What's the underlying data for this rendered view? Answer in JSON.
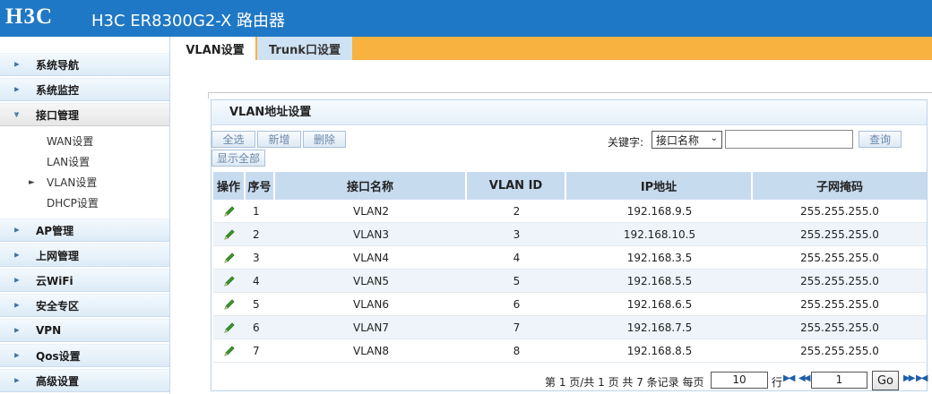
{
  "header": {
    "logo": "H3C",
    "title": "H3C ER8300G2-X 路由器"
  },
  "sidebar": {
    "groups": [
      {
        "label": "系统导航"
      },
      {
        "label": "系统监控"
      },
      {
        "label": "接口管理",
        "open": true
      },
      {
        "label": "AP管理"
      },
      {
        "label": "上网管理"
      },
      {
        "label": "云WiFi"
      },
      {
        "label": "安全专区"
      },
      {
        "label": "VPN"
      },
      {
        "label": "Qos设置"
      },
      {
        "label": "高级设置"
      }
    ],
    "subitems": [
      "WAN设置",
      "LAN设置",
      "VLAN设置",
      "DHCP设置"
    ],
    "active_sub": "VLAN设置"
  },
  "tabs": {
    "active": "VLAN设置",
    "other": "Trunk口设置"
  },
  "panel": {
    "title": "VLAN地址设置",
    "buttons": {
      "select_all": "全选",
      "add": "新增",
      "delete": "删除",
      "show_all": "显示全部"
    },
    "search": {
      "label": "关键字:",
      "selected": "接口名称",
      "value": "",
      "button": "查询"
    }
  },
  "table": {
    "headers": [
      "操作",
      "序号",
      "接口名称",
      "VLAN ID",
      "IP地址",
      "子网掩码"
    ],
    "rows": [
      [
        "1",
        "VLAN2",
        "2",
        "192.168.9.5",
        "255.255.255.0"
      ],
      [
        "2",
        "VLAN3",
        "3",
        "192.168.10.5",
        "255.255.255.0"
      ],
      [
        "3",
        "VLAN4",
        "4",
        "192.168.3.5",
        "255.255.255.0"
      ],
      [
        "4",
        "VLAN5",
        "5",
        "192.168.5.5",
        "255.255.255.0"
      ],
      [
        "5",
        "VLAN6",
        "6",
        "192.168.6.5",
        "255.255.255.0"
      ],
      [
        "6",
        "VLAN7",
        "7",
        "192.168.7.5",
        "255.255.255.0"
      ],
      [
        "7",
        "VLAN8",
        "8",
        "192.168.8.5",
        "255.255.255.0"
      ]
    ]
  },
  "pager": {
    "summary": "第 1 页/共 1 页 共 7 条记录 每页",
    "per_page": "10",
    "row_label": "行",
    "page": "1",
    "go": "Go"
  },
  "colors": {
    "header_bg": "#1f78c5",
    "tab_bar": "#f7b23f",
    "table_header": "#c7dbef",
    "pencil": "#3c9a2a"
  },
  "icons": [
    "pencil-edit-icon",
    "sidebar-arrow-icon",
    "page-first-icon",
    "page-prev-icon",
    "page-next-icon",
    "page-last-icon",
    "dropdown-caret-icon"
  ]
}
